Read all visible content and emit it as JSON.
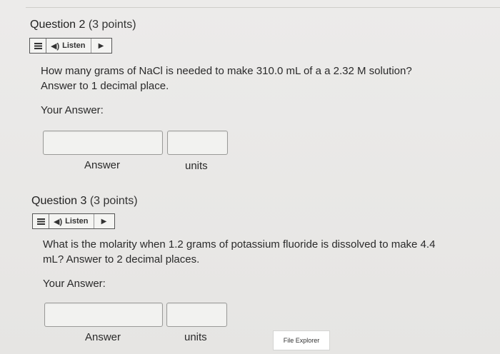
{
  "question2": {
    "title_num": "Question 2",
    "title_pts": "(3 points)",
    "listen_label": "Listen",
    "text_line1": "How many grams of NaCl is needed to make 310.0 mL of a a 2.32 M solution?",
    "text_line2": "Answer to 1 decimal place.",
    "your_answer": "Your Answer:",
    "answer_label": "Answer",
    "units_label": "units"
  },
  "question3": {
    "title_num": "Question 3",
    "title_pts": "(3 points)",
    "listen_label": "Listen",
    "text_line1": "What is the molarity when 1.2 grams of potassium fluoride is dissolved to make 4.4",
    "text_line2": "mL? Answer to 2 decimal places.",
    "your_answer": "Your Answer:",
    "answer_label": "Answer",
    "units_label": "units"
  },
  "overlay": {
    "file_explorer": "File Explorer"
  },
  "icons": {
    "menu": "menu-icon",
    "speaker": "speaker-icon",
    "play": "play-icon"
  }
}
